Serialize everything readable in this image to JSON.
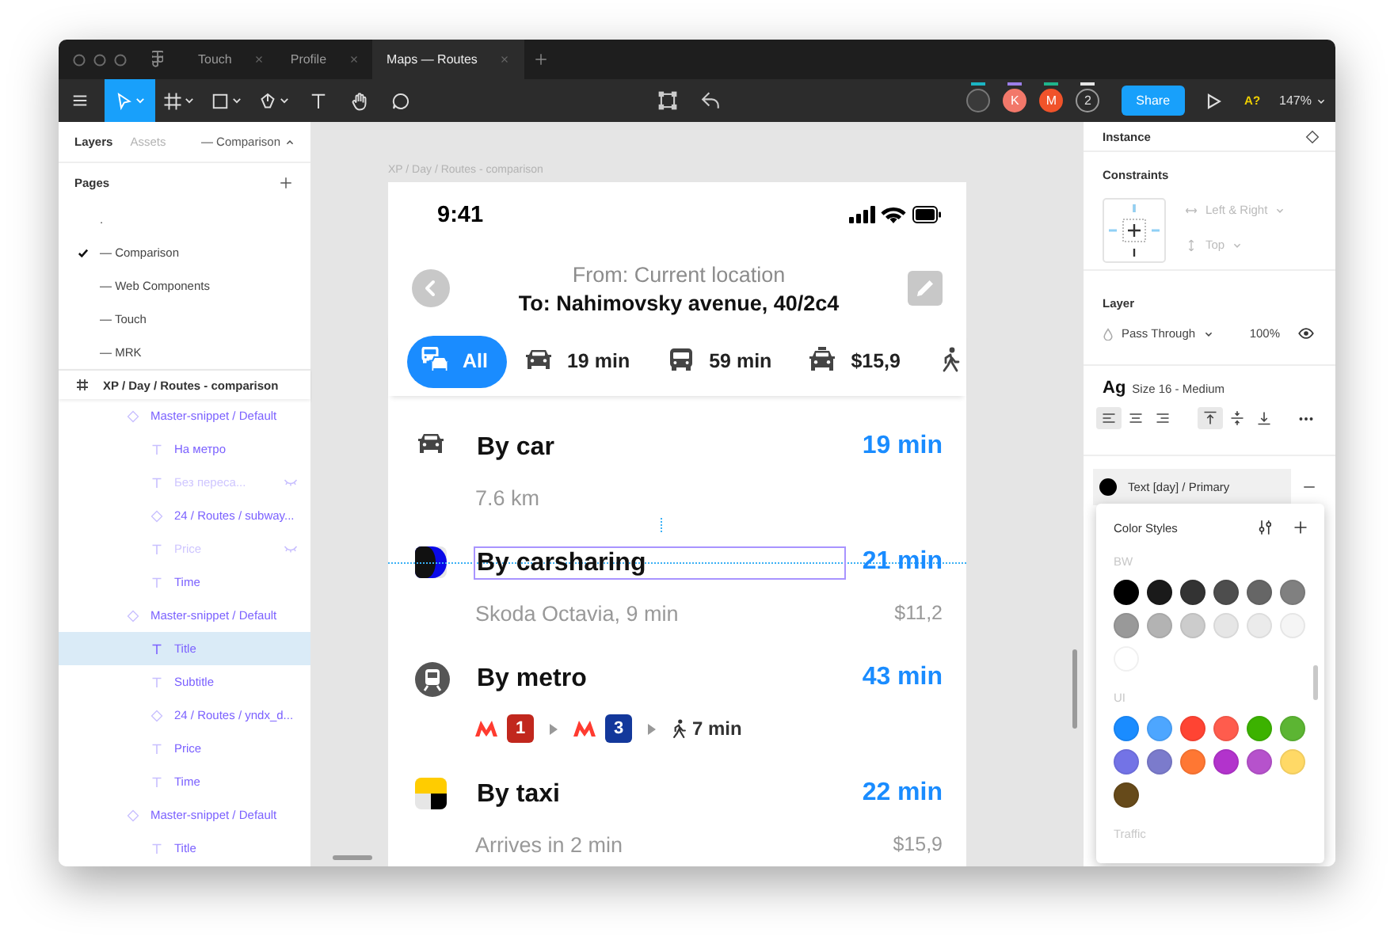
{
  "window": {
    "tabs": [
      {
        "label": "Touch",
        "selected": false
      },
      {
        "label": "Profile",
        "selected": false
      },
      {
        "label": "Maps — Routes",
        "selected": true
      }
    ]
  },
  "toolbar": {
    "tools": [
      {
        "kind": "move",
        "selected": true
      },
      {
        "kind": "frame",
        "selected": false
      },
      {
        "kind": "shape",
        "selected": false
      },
      {
        "kind": "pen",
        "selected": false
      },
      {
        "kind": "text",
        "selected": false
      },
      {
        "kind": "hand",
        "selected": false
      },
      {
        "kind": "comment",
        "selected": false
      }
    ],
    "collaborators": [
      {
        "kind": "photo",
        "color": "#1bb5c4"
      },
      {
        "kind": "initial",
        "initial": "K",
        "color": "#f2786a",
        "bar": {
          "color": "#9b7ee8"
        }
      },
      {
        "kind": "initial",
        "initial": "M",
        "color": "#f0532a",
        "bar": {
          "color": "#1fb48c"
        }
      },
      {
        "kind": "count",
        "count": "2",
        "color": "#e6e6e6"
      }
    ],
    "share": "Share",
    "accessibility": "A?",
    "zoom": "147%"
  },
  "left_panel": {
    "tabs": [
      {
        "label": "Layers",
        "selected": true
      },
      {
        "label": "Assets",
        "selected": false
      }
    ],
    "page_switcher": "— Comparison",
    "pages_title": "Pages",
    "pages": [
      {
        "label": ".",
        "selected": false
      },
      {
        "label": "— Comparison",
        "selected": true
      },
      {
        "label": "— Web Components",
        "selected": false
      },
      {
        "label": "— Touch",
        "selected": false
      },
      {
        "label": "— MRK",
        "selected": false
      }
    ],
    "frame": "XP / Day / Routes - comparison",
    "layers": [
      {
        "kind": "component",
        "label": "Master-snippet / Default",
        "hidden": false,
        "selected": false,
        "children": [
          {
            "kind": "text",
            "label": "На метро",
            "hidden": false,
            "selected": false
          },
          {
            "kind": "text",
            "label": "Без переса...",
            "hidden": true,
            "selected": false
          },
          {
            "kind": "component",
            "label": "24 / Routes / subway...",
            "hidden": false,
            "selected": false
          },
          {
            "kind": "text",
            "label": "Price",
            "hidden": true,
            "selected": false
          },
          {
            "kind": "text",
            "label": "Time",
            "hidden": false,
            "selected": false
          }
        ]
      },
      {
        "kind": "component",
        "label": "Master-snippet / Default",
        "hidden": false,
        "selected": false,
        "children": [
          {
            "kind": "text",
            "label": "Title",
            "hidden": false,
            "selected": true
          },
          {
            "kind": "text",
            "label": "Subtitle",
            "hidden": false,
            "selected": false
          },
          {
            "kind": "component",
            "label": "24 / Routes / yndx_d...",
            "hidden": false,
            "selected": false
          },
          {
            "kind": "text",
            "label": "Price",
            "hidden": false,
            "selected": false
          },
          {
            "kind": "text",
            "label": "Time",
            "hidden": false,
            "selected": false
          }
        ]
      },
      {
        "kind": "component",
        "label": "Master-snippet / Default",
        "hidden": false,
        "selected": false,
        "children": [
          {
            "kind": "text",
            "label": "Title",
            "hidden": false,
            "selected": false
          }
        ]
      }
    ]
  },
  "canvas": {
    "frame_label": "XP / Day / Routes - comparison",
    "phone": {
      "time": "9:41",
      "from": "From: Current location",
      "to": "To: Nahimovsky avenue, 40/2c4",
      "modes": [
        {
          "kind": "all",
          "label": "All",
          "selected": true
        },
        {
          "kind": "car",
          "label": "19 min",
          "selected": false
        },
        {
          "kind": "bus",
          "label": "59 min",
          "selected": false
        },
        {
          "kind": "taxi",
          "label": "$15,9",
          "selected": false
        },
        {
          "kind": "walk",
          "selected": false
        }
      ],
      "routes": [
        {
          "kind": "car",
          "title": "By car",
          "subtitle": "7.6 km",
          "time": "19 min",
          "selected": false
        },
        {
          "kind": "carsharing",
          "title": "By carsharing",
          "subtitle": "Skoda Octavia, 9 min",
          "time": "21 min",
          "price": "$11,2",
          "selected": true
        },
        {
          "kind": "metro",
          "title": "By metro",
          "time": "43 min",
          "selected": false,
          "steps": [
            {
              "kind": "metro",
              "line": "1",
              "color": "#c1271d"
            },
            {
              "kind": "metro",
              "line": "3",
              "color": "#13389b"
            },
            {
              "kind": "walk",
              "label": "7 min"
            }
          ]
        },
        {
          "kind": "taxi",
          "title": "By taxi",
          "subtitle": "Arrives in 2 min",
          "time": "22 min",
          "price": "$15,9",
          "selected": false
        }
      ]
    }
  },
  "right_panel": {
    "instance_title": "Instance",
    "constraints": {
      "title": "Constraints",
      "horizontal": "Left & Right",
      "vertical": "Top"
    },
    "layer": {
      "title": "Layer",
      "blend": "Pass Through",
      "opacity": "100%",
      "visible": true
    },
    "text": {
      "sample": "Ag",
      "style": "Size 16 - Medium",
      "align": [
        {
          "kind": "left",
          "selected": true
        },
        {
          "kind": "center",
          "selected": false
        },
        {
          "kind": "right",
          "selected": false
        }
      ],
      "vertical_align": [
        {
          "kind": "top",
          "selected": true
        },
        {
          "kind": "middle",
          "selected": false
        },
        {
          "kind": "bottom",
          "selected": false
        }
      ]
    },
    "fill": {
      "name": "Text [day] / Primary",
      "color": "#000000"
    },
    "color_styles": {
      "title": "Color Styles",
      "groups": [
        {
          "name": "BW",
          "swatches": [
            {
              "color": "#000000"
            },
            {
              "color": "#1a1a1a"
            },
            {
              "color": "#333333"
            },
            {
              "color": "#4d4d4d"
            },
            {
              "color": "#666666"
            },
            {
              "color": "#808080"
            },
            {
              "color": "#999999"
            },
            {
              "color": "#b3b3b3"
            },
            {
              "color": "#cccccc"
            },
            {
              "color": "#e6e6e6"
            },
            {
              "color": "#ebebeb"
            },
            {
              "color": "#f5f5f5"
            },
            {
              "color": "#ffffff"
            }
          ]
        },
        {
          "name": "UI",
          "swatches": [
            {
              "color": "#1a8cff"
            },
            {
              "color": "#4da6ff"
            },
            {
              "color": "#ff4433"
            },
            {
              "color": "#ff5c4d"
            },
            {
              "color": "#3cb200"
            },
            {
              "color": "#5cb533"
            },
            {
              "color": "#7373e6"
            },
            {
              "color": "#7b7bcc"
            },
            {
              "color": "#ff7733"
            },
            {
              "color": "#b233cc"
            },
            {
              "color": "#b652cc"
            },
            {
              "color": "#ffd966"
            },
            {
              "color": "#664a1a"
            }
          ]
        },
        {
          "name": "Traffic"
        }
      ]
    }
  }
}
